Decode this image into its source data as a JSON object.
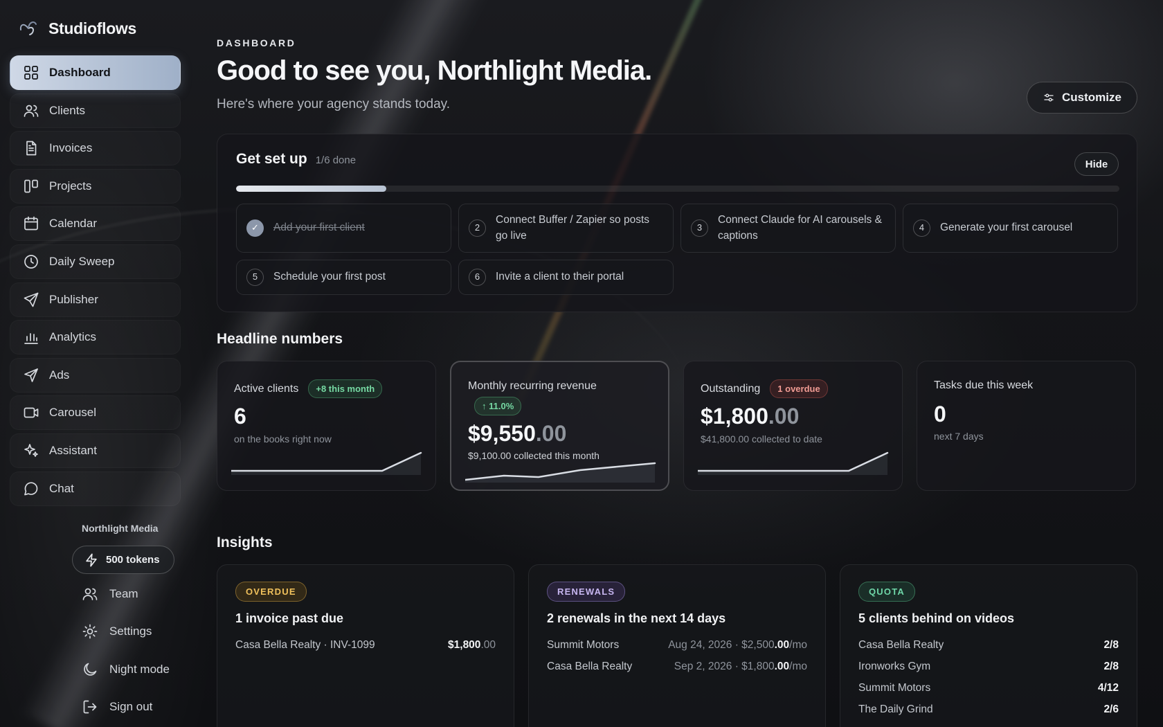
{
  "brand": {
    "name": "Studioflows"
  },
  "sidebar": {
    "items": [
      {
        "label": "Dashboard",
        "icon": "grid-icon",
        "active": true
      },
      {
        "label": "Clients",
        "icon": "users-icon"
      },
      {
        "label": "Invoices",
        "icon": "document-icon"
      },
      {
        "label": "Projects",
        "icon": "columns-icon"
      },
      {
        "label": "Calendar",
        "icon": "calendar-icon"
      },
      {
        "label": "Daily Sweep",
        "icon": "clock-icon"
      },
      {
        "label": "Publisher",
        "icon": "send-icon"
      },
      {
        "label": "Analytics",
        "icon": "bar-chart-icon"
      },
      {
        "label": "Ads",
        "icon": "navigation-icon"
      },
      {
        "label": "Carousel",
        "icon": "video-icon"
      },
      {
        "label": "Assistant",
        "icon": "sparkle-icon"
      },
      {
        "label": "Chat",
        "icon": "chat-bubble-icon"
      }
    ],
    "org_name": "Northlight Media",
    "tokens_label": "500 tokens",
    "footer": {
      "team": "Team",
      "settings": "Settings",
      "night_mode": "Night mode",
      "sign_out": "Sign out"
    }
  },
  "header": {
    "eyebrow": "DASHBOARD",
    "title": "Good to see you, Northlight Media.",
    "subtitle": "Here's where your agency stands today.",
    "customize_label": "Customize"
  },
  "setup": {
    "title": "Get set up",
    "count": "1/6 done",
    "hide_label": "Hide",
    "progress": 0.17,
    "steps": [
      {
        "num": "✓",
        "text": "Add your first client",
        "done": true
      },
      {
        "num": "2",
        "text": "Connect Buffer / Zapier so posts go live"
      },
      {
        "num": "3",
        "text": "Connect Claude for AI carousels & captions"
      },
      {
        "num": "4",
        "text": "Generate your first carousel"
      },
      {
        "num": "5",
        "text": "Schedule your first post"
      },
      {
        "num": "6",
        "text": "Invite a client to their portal"
      }
    ]
  },
  "headline": {
    "title": "Headline numbers",
    "cards": [
      {
        "label": "Active clients",
        "badge": "+8 this month",
        "value": "6",
        "cents": "",
        "sub": "on the books right now"
      },
      {
        "label": "Monthly recurring revenue",
        "badge": "↑ 11.0%",
        "value": "$9,550",
        "cents": ".00",
        "sub": "$9,100.00 collected this month"
      },
      {
        "label": "Outstanding",
        "badge": "1 overdue",
        "value": "$1,800",
        "cents": ".00",
        "sub": "$41,800.00 collected to date"
      },
      {
        "label": "Tasks due this week",
        "badge": "",
        "value": "0",
        "cents": "",
        "sub": "next 7 days"
      }
    ]
  },
  "insights": {
    "title": "Insights",
    "cards": [
      {
        "tag": "OVERDUE",
        "title": "1 invoice past due",
        "rows": [
          {
            "left": "Casa Bella Realty · INV-1099",
            "amount": "$1,800",
            "cents": ".00"
          }
        ]
      },
      {
        "tag": "RENEWALS",
        "title": "2 renewals in the next 14 days",
        "rows": [
          {
            "left": "Summit Motors",
            "date": "Aug 24, 2026 · $2,500",
            "cents": ".00",
            "suffix": "/mo"
          },
          {
            "left": "Casa Bella Realty",
            "date": "Sep 2, 2026 · $1,800",
            "cents": ".00",
            "suffix": "/mo"
          }
        ]
      },
      {
        "tag": "QUOTA",
        "title": "5 clients behind on videos",
        "rows": [
          {
            "left": "Casa Bella Realty",
            "right": "2/8"
          },
          {
            "left": "Ironworks Gym",
            "right": "2/8"
          },
          {
            "left": "Summit Motors",
            "right": "4/12"
          },
          {
            "left": "The Daily Grind",
            "right": "2/6"
          }
        ]
      }
    ]
  }
}
